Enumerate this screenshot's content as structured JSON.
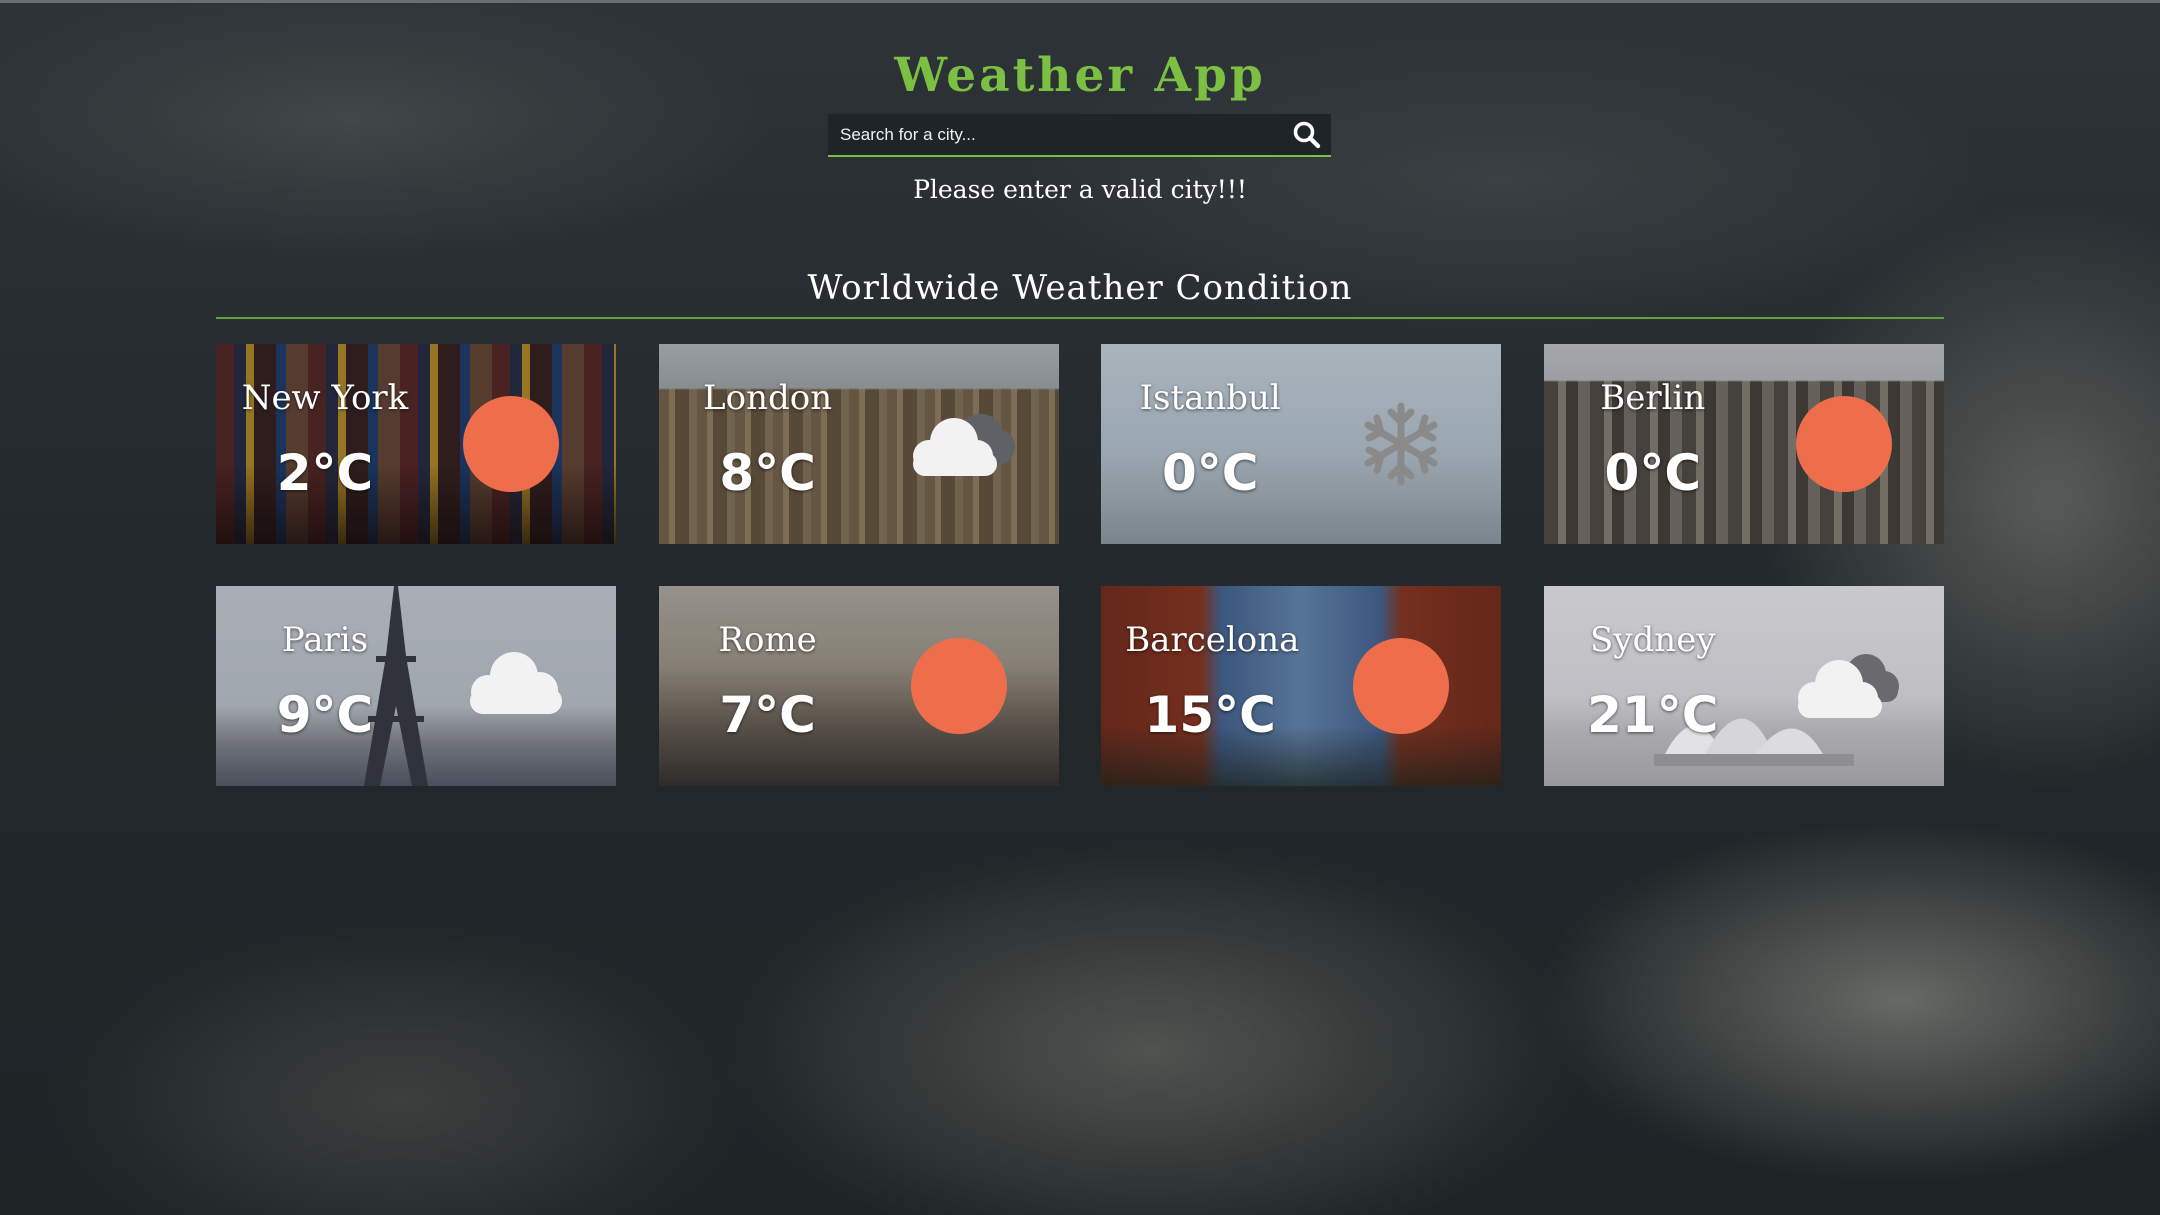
{
  "header": {
    "title": "Weather App"
  },
  "search": {
    "placeholder": "Search for a city...",
    "value": ""
  },
  "message": {
    "error": "Please enter a valid city!!!"
  },
  "section": {
    "title": "Worldwide Weather Condition"
  },
  "colors": {
    "accent": "#7cc043",
    "sun": "#ee6e4c",
    "cloud": "#f2f2f2",
    "snow": "#8a8a8a"
  },
  "cities": [
    {
      "name": "New York",
      "temp": "2°C",
      "condition_icon": "sun-icon"
    },
    {
      "name": "London",
      "temp": "8°C",
      "condition_icon": "cloudy-icon"
    },
    {
      "name": "Istanbul",
      "temp": "0°C",
      "condition_icon": "snowflake-icon"
    },
    {
      "name": "Berlin",
      "temp": "0°C",
      "condition_icon": "sun-icon"
    },
    {
      "name": "Paris",
      "temp": "9°C",
      "condition_icon": "cloud-icon"
    },
    {
      "name": "Rome",
      "temp": "7°C",
      "condition_icon": "sun-icon"
    },
    {
      "name": "Barcelona",
      "temp": "15°C",
      "condition_icon": "sun-icon"
    },
    {
      "name": "Sydney",
      "temp": "21°C",
      "condition_icon": "cloudy-icon"
    }
  ]
}
